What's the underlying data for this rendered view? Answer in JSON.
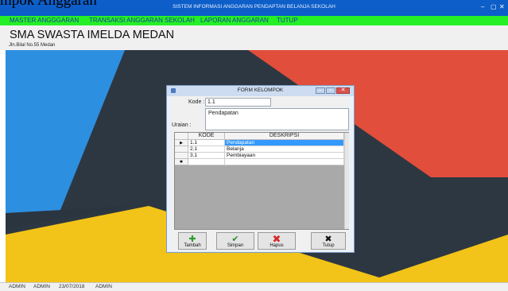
{
  "caption": "mpok Anggaran",
  "window": {
    "title": "SISTEM INFORMASI ANGGARAN PENDAPTAN BELANJA SEKOLAH",
    "controls": [
      "–",
      "▢",
      "✕"
    ]
  },
  "menu": [
    "MASTER ANGGGARAN",
    "TRANSAKSI ANGGARAN SEKOLAH",
    "LAPORAN ANGGARAN",
    "TUTUP"
  ],
  "header": {
    "school_name": "SMA SWASTA IMELDA MEDAN",
    "address": "Jln.Bilal No.55 Medan"
  },
  "form": {
    "title": "FORM KELOMPOK",
    "kode_label": "Kode :",
    "kode_value": "1.1",
    "uraian_label": "Uraian :",
    "uraian_value": "Pendapatan",
    "grid": {
      "columns": [
        "KODE",
        "DESKRIPSI"
      ],
      "rows": [
        {
          "marker": "▶",
          "kode": "1.1",
          "deskripsi": "Pendapatan",
          "selected": true
        },
        {
          "marker": "",
          "kode": "2.1",
          "deskripsi": "Belanja",
          "selected": false
        },
        {
          "marker": "",
          "kode": "3.1",
          "deskripsi": "Pembiayaan",
          "selected": false
        },
        {
          "marker": "✱",
          "kode": "",
          "deskripsi": "",
          "selected": false
        }
      ]
    },
    "buttons": {
      "tambah": "Tambah",
      "simpan": "Simpan",
      "hapus": "Hapus",
      "tutup": "Tutup"
    }
  },
  "status": [
    "ADMIN",
    "ADMIN",
    "23/07/2018",
    "ADMIN"
  ],
  "colors": {
    "titlebar": "#0d5ec9",
    "menubar": "#25f025",
    "menu_text": "#1b3d9a",
    "bg_blue": "#2d8fe0",
    "bg_red": "#e14e3c",
    "bg_yellow": "#f2c318",
    "bg_dark": "#2d3741",
    "selection": "#3399ff"
  }
}
